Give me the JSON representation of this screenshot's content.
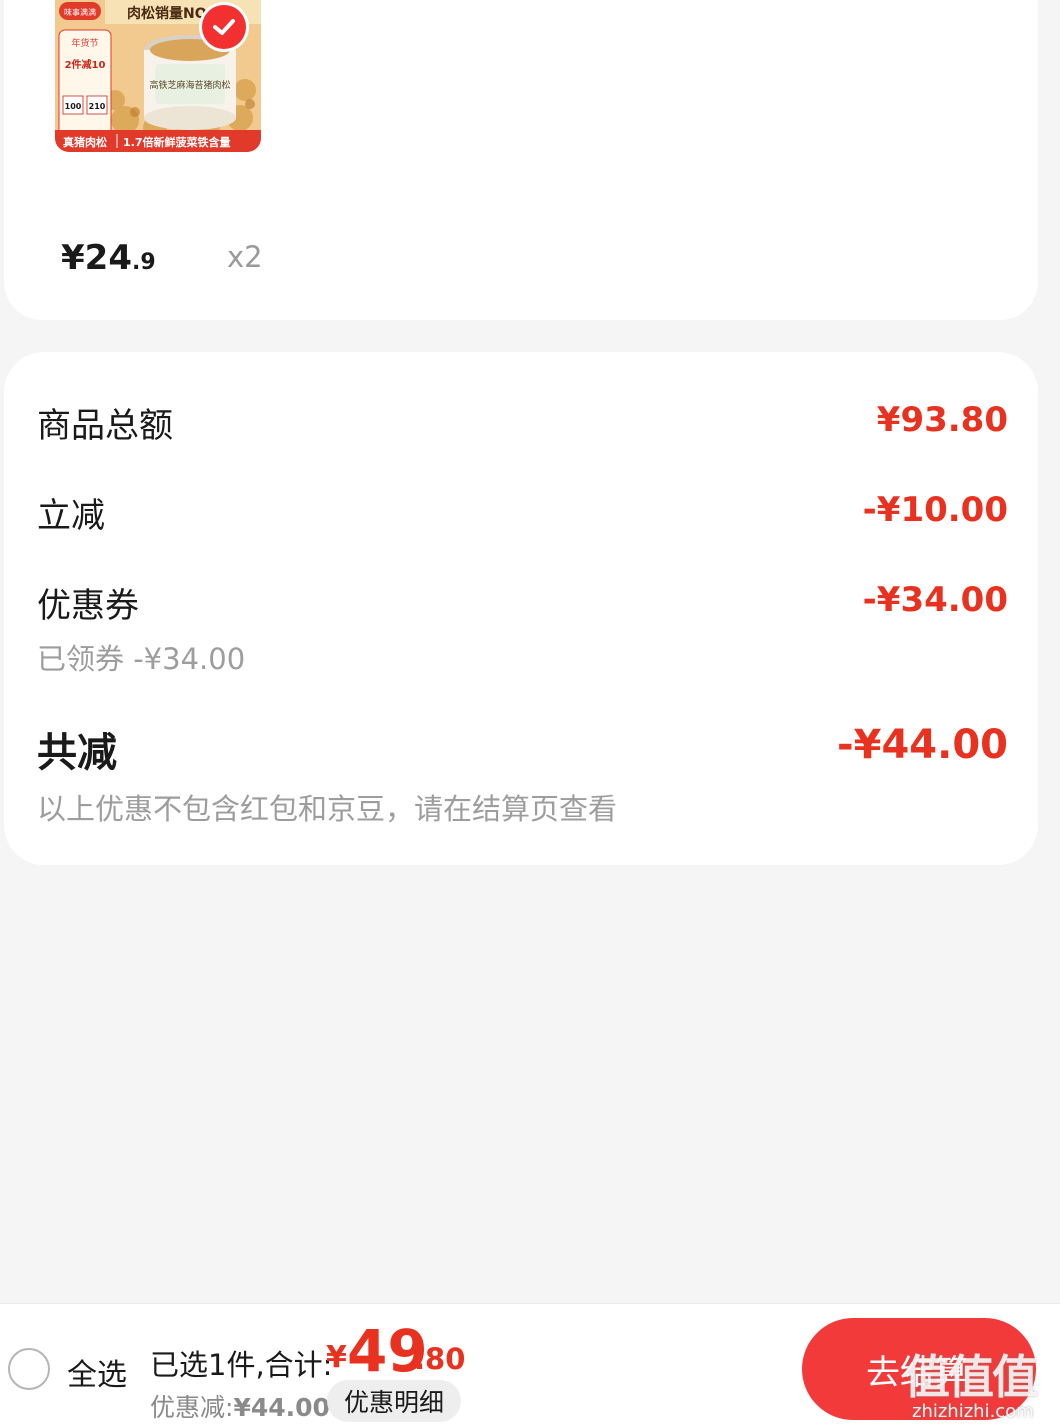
{
  "product": {
    "image_alt": "肉松产品图",
    "image_banner_top": "肉松销量NO",
    "image_brand": "味事满满",
    "image_tag": "年货节",
    "image_promo": "2件减10",
    "image_can_text": "高铁芝麻海苔猪肉松",
    "image_stat_1": "100",
    "image_stat_2": "210",
    "image_footer_left": "真猪肉松",
    "image_footer_right": "1.7倍新鲜菠菜铁含量",
    "price_int": "¥24",
    "price_cents": ".9",
    "quantity": "x2",
    "selected": true
  },
  "summary": {
    "goods_total_label": "商品总额",
    "goods_total_value": "¥93.80",
    "instant_off_label": "立减",
    "instant_off_value": "-¥10.00",
    "coupon_label": "优惠券",
    "coupon_value": "-¥34.00",
    "coupon_sub": "已领券 -¥34.00",
    "total_off_label": "共减",
    "total_off_value": "-¥44.00",
    "note": "以上优惠不包含红包和京豆，请在结算页查看"
  },
  "bottom_bar": {
    "select_all_label": "全选",
    "selected_summary": "已选1件,合计:",
    "currency": "¥",
    "amount_int": "49",
    "amount_cents": ".80",
    "discount_label": "优惠减:",
    "discount_value": "¥44.00",
    "detail_button_label": "优惠明细",
    "checkout_label": "去结算"
  },
  "watermark": {
    "text": "值值值",
    "url": "zhizhizhi.com"
  },
  "colors": {
    "accent_red": "#e8321f",
    "button_red": "#f23a3a",
    "background": "#f5f5f5"
  },
  "icons": {
    "check": "check-icon",
    "radio": "radio-unchecked-icon"
  }
}
